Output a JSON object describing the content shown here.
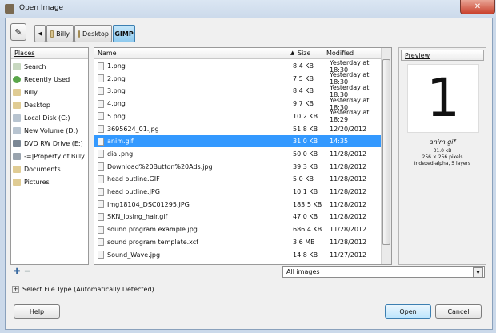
{
  "window": {
    "title": "Open Image"
  },
  "path_buttons": [
    {
      "label": "Billy"
    },
    {
      "label": "Desktop"
    },
    {
      "label": "GIMP"
    }
  ],
  "places": {
    "header": "Places",
    "items": [
      {
        "label": "Search",
        "icon": "search-icon"
      },
      {
        "label": "Recently Used",
        "icon": "recent-icon"
      },
      {
        "label": "Billy",
        "icon": "folder-icon"
      },
      {
        "label": "Desktop",
        "icon": "folder-icon"
      },
      {
        "label": "Local Disk (C:)",
        "icon": "disk-icon"
      },
      {
        "label": "New Volume (D:)",
        "icon": "disk-icon"
      },
      {
        "label": "DVD RW Drive (E:)",
        "icon": "dvd-icon"
      },
      {
        "label": "-=|Property of Billy ...",
        "icon": "drive-icon"
      },
      {
        "label": "Documents",
        "icon": "folder-icon"
      },
      {
        "label": "Pictures",
        "icon": "folder-icon"
      }
    ]
  },
  "files": {
    "headers": {
      "name": "Name",
      "size": "Size",
      "modified": "Modified"
    },
    "rows": [
      {
        "name": "1.png",
        "size": "8.4 KB",
        "modified": "Yesterday at 18:30"
      },
      {
        "name": "2.png",
        "size": "7.5 KB",
        "modified": "Yesterday at 18:30"
      },
      {
        "name": "3.png",
        "size": "8.4 KB",
        "modified": "Yesterday at 18:30"
      },
      {
        "name": "4.png",
        "size": "9.7 KB",
        "modified": "Yesterday at 18:30"
      },
      {
        "name": "5.png",
        "size": "10.2 KB",
        "modified": "Yesterday at 18:29"
      },
      {
        "name": "3695624_01.jpg",
        "size": "51.8 KB",
        "modified": "12/20/2012"
      },
      {
        "name": "anim.gif",
        "size": "31.0 KB",
        "modified": "14:35",
        "selected": true
      },
      {
        "name": "dial.png",
        "size": "50.0 KB",
        "modified": "11/28/2012"
      },
      {
        "name": "Download%20Button%20Ads.jpg",
        "size": "39.3 KB",
        "modified": "11/28/2012"
      },
      {
        "name": "head outline.GIF",
        "size": "5.0 KB",
        "modified": "11/28/2012"
      },
      {
        "name": "head outline.JPG",
        "size": "10.1 KB",
        "modified": "11/28/2012"
      },
      {
        "name": "Img18104_DSC01295.JPG",
        "size": "183.5 KB",
        "modified": "11/28/2012"
      },
      {
        "name": "SKN_losing_hair.gif",
        "size": "47.0 KB",
        "modified": "11/28/2012"
      },
      {
        "name": "sound program example.jpg",
        "size": "686.4 KB",
        "modified": "11/28/2012"
      },
      {
        "name": "sound program template.xcf",
        "size": "3.6 MB",
        "modified": "11/28/2012"
      },
      {
        "name": "Sound_Wave.jpg",
        "size": "14.8 KB",
        "modified": "11/27/2012"
      }
    ]
  },
  "preview": {
    "header": "Preview",
    "image_glyph": "1",
    "filename": "anim.gif",
    "info1": "31.0 kB",
    "info2": "256 × 256 pixels",
    "info3": "Indexed-alpha, 5 layers"
  },
  "filter": {
    "selected": "All images"
  },
  "select_file_type": {
    "label": "Select File Type (Automatically Detected)"
  },
  "buttons": {
    "help": "Help",
    "open": "Open",
    "cancel": "Cancel"
  },
  "colors": {
    "selection": "#3399ff",
    "accent_path": "#9cd3f4"
  }
}
